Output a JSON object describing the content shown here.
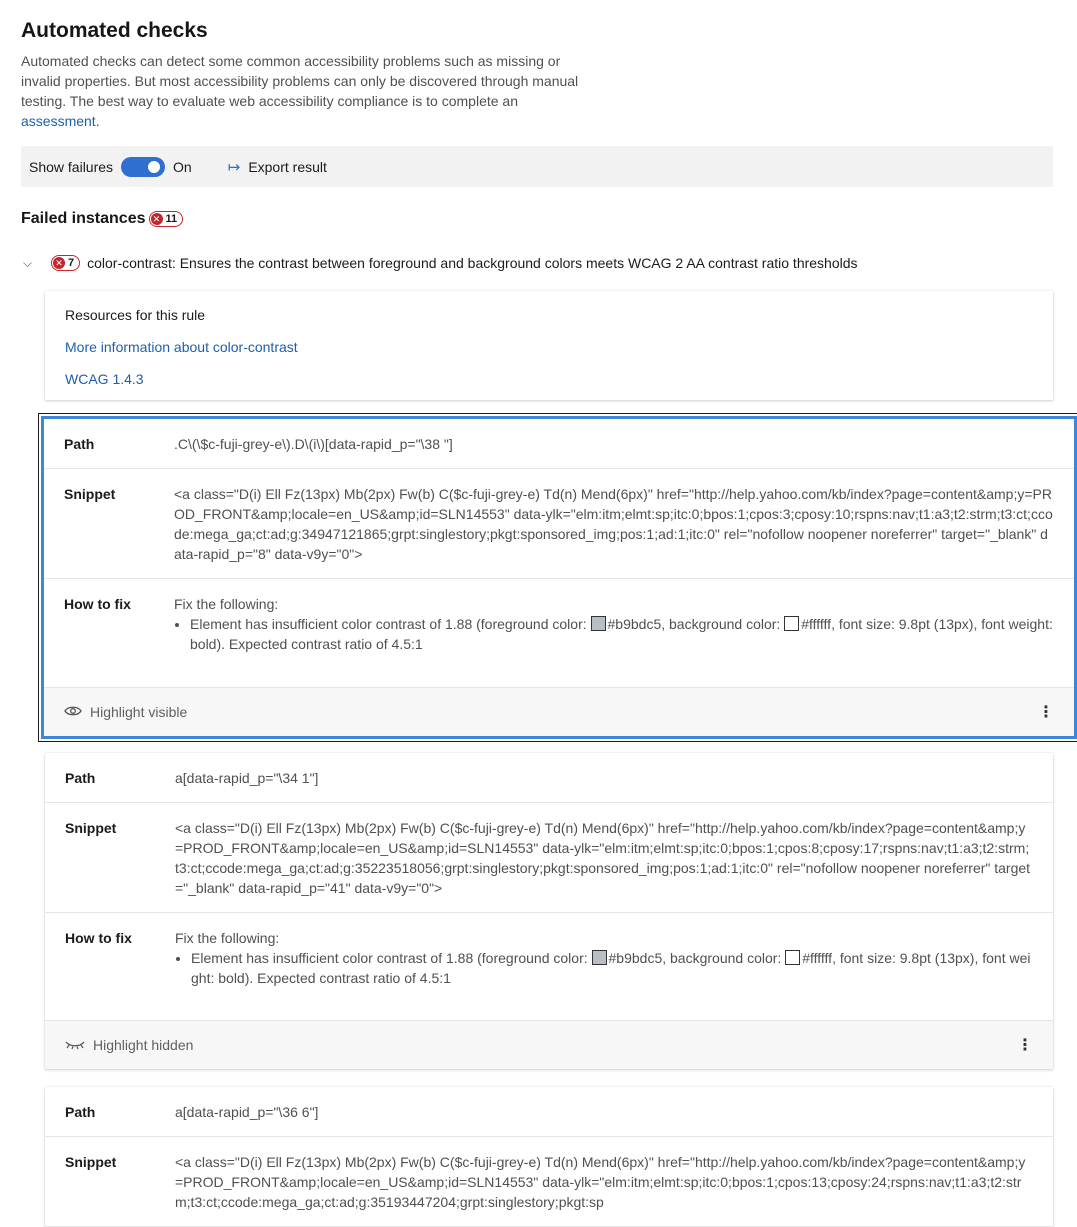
{
  "header": {
    "title": "Automated checks",
    "intro_text": "Automated checks can detect some common accessibility problems such as missing or invalid properties. But most accessibility problems can only be discovered through manual testing. The best way to evaluate web accessibility compliance is to complete an ",
    "intro_link": "assessment",
    "intro_end": "."
  },
  "commandbar": {
    "show_failures_label": "Show failures",
    "toggle_state": "On",
    "export_label": "Export result"
  },
  "failed": {
    "title": "Failed instances",
    "count": "11"
  },
  "rule": {
    "count": "7",
    "text": "color-contrast: Ensures the contrast between foreground and background colors meets WCAG 2 AA contrast ratio thresholds"
  },
  "resources": {
    "title": "Resources for this rule",
    "link1": "More information about color-contrast",
    "link2": "WCAG 1.4.3"
  },
  "labels": {
    "path": "Path",
    "snippet": "Snippet",
    "howto": "How to fix",
    "fix_intro": "Fix the following:"
  },
  "colors": {
    "foreground": "#b9bdc5",
    "background": "#ffffff",
    "accent": "#2f6fcf",
    "error": "#c4262e"
  },
  "instances": [
    {
      "path": ".C\\(\\$c-fuji-grey-e\\).D\\(i\\)[data-rapid_p=\"\\38 \"]",
      "snippet": "<a class=\"D(i) Ell Fz(13px) Mb(2px) Fw(b) C($c-fuji-grey-e) Td(n) Mend(6px)\" href=\"http://help.yahoo.com/kb/index?page=content&amp;y=PROD_FRONT&amp;locale=en_US&amp;id=SLN14553\" data-ylk=\"elm:itm;elmt:sp;itc:0;bpos:1;cpos:3;cposy:10;rspns:nav;t1:a3;t2:strm;t3:ct;ccode:mega_ga;ct:ad;g:34947121865;grpt:singlestory;pkgt:sponsored_img;pos:1;ad:1;itc:0\" rel=\"nofollow noopener noreferrer\" target=\"_blank\" data-rapid_p=\"8\" data-v9y=\"0\">",
      "fix_a": "Element has insufficient color contrast of 1.88 (foreground color: ",
      "fix_fg": "#b9bdc5",
      "fix_b": ", background color: ",
      "fix_bg": "#ffffff",
      "fix_c": ", font size: 9.8pt (13px), font weight: bold). Expected contrast ratio of 4.5:1",
      "highlight": "Highlight visible"
    },
    {
      "path": "a[data-rapid_p=\"\\34 1\"]",
      "snippet": "<a class=\"D(i) Ell Fz(13px) Mb(2px) Fw(b) C($c-fuji-grey-e) Td(n) Mend(6px)\" href=\"http://help.yahoo.com/kb/index?page=content&amp;y=PROD_FRONT&amp;locale=en_US&amp;id=SLN14553\" data-ylk=\"elm:itm;elmt:sp;itc:0;bpos:1;cpos:8;cposy:17;rspns:nav;t1:a3;t2:strm;t3:ct;ccode:mega_ga;ct:ad;g:35223518056;grpt:singlestory;pkgt:sponsored_img;pos:1;ad:1;itc:0\" rel=\"nofollow noopener noreferrer\" target=\"_blank\" data-rapid_p=\"41\" data-v9y=\"0\">",
      "fix_a": "Element has insufficient color contrast of 1.88 (foreground color: ",
      "fix_fg": "#b9bdc5",
      "fix_b": ", background color: ",
      "fix_bg": "#ffffff",
      "fix_c": ", font size: 9.8pt (13px), font weight: bold). Expected contrast ratio of 4.5:1",
      "highlight": "Highlight hidden"
    },
    {
      "path": "a[data-rapid_p=\"\\36 6\"]",
      "snippet": "<a class=\"D(i) Ell Fz(13px) Mb(2px) Fw(b) C($c-fuji-grey-e) Td(n) Mend(6px)\" href=\"http://help.yahoo.com/kb/index?page=content&amp;y=PROD_FRONT&amp;locale=en_US&amp;id=SLN14553\" data-ylk=\"elm:itm;elmt:sp;itc:0;bpos:1;cpos:13;cposy:24;rspns:nav;t1:a3;t2:strm;t3:ct;ccode:mega_ga;ct:ad;g:35193447204;grpt:singlestory;pkgt:sp"
    }
  ]
}
